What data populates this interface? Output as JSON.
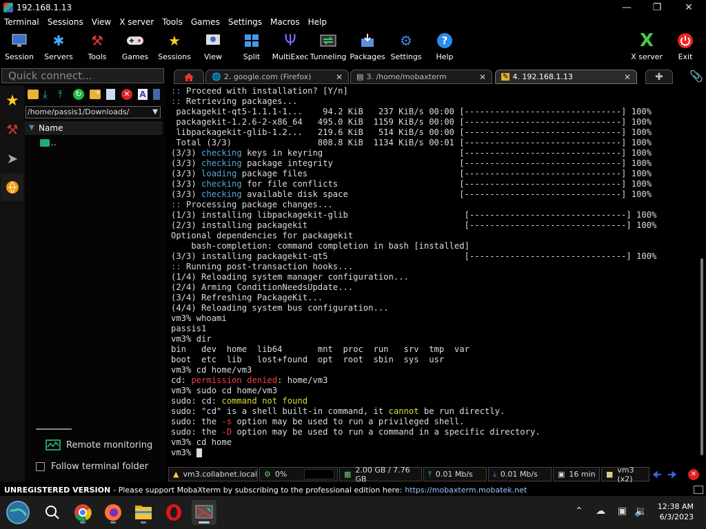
{
  "window": {
    "title": "192.168.1.13"
  },
  "menu": [
    "Terminal",
    "Sessions",
    "View",
    "X server",
    "Tools",
    "Games",
    "Settings",
    "Macros",
    "Help"
  ],
  "toolbar": {
    "items": [
      "Session",
      "Servers",
      "Tools",
      "Games",
      "Sessions",
      "View",
      "Split",
      "MultiExec",
      "Tunneling",
      "Packages",
      "Settings",
      "Help"
    ],
    "xserver": "X server",
    "exit": "Exit"
  },
  "quick_connect": {
    "placeholder": "Quick connect..."
  },
  "tabs": [
    {
      "label": "2. google.com (Firefox)"
    },
    {
      "label": "3. /home/mobaxterm"
    },
    {
      "label": "4. 192.168.1.13"
    }
  ],
  "sftp": {
    "path": "/home/passis1/Downloads/",
    "column": "Name",
    "updir": "..",
    "remote_monitoring": "Remote monitoring",
    "follow_folder": "Follow terminal folder"
  },
  "terminal": {
    "lines": [
      [
        {
          "t": ":: ",
          "c": "cyan"
        },
        {
          "t": "Proceed with installation? [Y/n]"
        }
      ],
      [
        {
          "t": ":: ",
          "c": "cyan"
        },
        {
          "t": "Retrieving packages..."
        }
      ],
      [
        {
          "t": " packagekit-qt5-1.1.1-1...    94.2 KiB   237 KiB/s 00:00 [-------------------------------] 100%"
        }
      ],
      [
        {
          "t": " packagekit-1.2.6-2-x86_64   495.0 KiB  1159 KiB/s 00:00 [-------------------------------] 100%"
        }
      ],
      [
        {
          "t": " libpackagekit-glib-1.2...   219.6 KiB   514 KiB/s 00:00 [-------------------------------] 100%"
        }
      ],
      [
        {
          "t": " Total (3/3)                 808.8 KiB  1134 KiB/s 00:01 [-------------------------------] 100%"
        }
      ],
      [
        {
          "t": "(3/3) "
        },
        {
          "t": "checking",
          "c": "cyan"
        },
        {
          "t": " keys in keyring                           [-------------------------------] 100%"
        }
      ],
      [
        {
          "t": "(3/3) "
        },
        {
          "t": "checking",
          "c": "cyan"
        },
        {
          "t": " package integrity                         [-------------------------------] 100%"
        }
      ],
      [
        {
          "t": "(3/3) "
        },
        {
          "t": "loading",
          "c": "cyan"
        },
        {
          "t": " package files                              [-------------------------------] 100%"
        }
      ],
      [
        {
          "t": "(3/3) "
        },
        {
          "t": "checking",
          "c": "cyan"
        },
        {
          "t": " for file conflicts                        [-------------------------------] 100%"
        }
      ],
      [
        {
          "t": "(3/3) "
        },
        {
          "t": "checking",
          "c": "cyan"
        },
        {
          "t": " available disk space                      [-------------------------------] 100%"
        }
      ],
      [
        {
          "t": ":: ",
          "c": "cyan"
        },
        {
          "t": "Processing package changes..."
        }
      ],
      [
        {
          "t": "(1/3) installing libpackagekit-glib                       [-------------------------------] 100%"
        }
      ],
      [
        {
          "t": "(2/3) installing packagekit                               [-------------------------------] 100%"
        }
      ],
      [
        {
          "t": "Optional dependencies for packagekit"
        }
      ],
      [
        {
          "t": "    bash-completion: command completion in bash [installed]"
        }
      ],
      [
        {
          "t": "(3/3) installing packagekit-qt5                           [-------------------------------] 100%"
        }
      ],
      [
        {
          "t": ":: ",
          "c": "cyan"
        },
        {
          "t": "Running post-transaction hooks..."
        }
      ],
      [
        {
          "t": "(1/4) Reloading system manager configuration..."
        }
      ],
      [
        {
          "t": "(2/4) Arming ConditionNeedsUpdate..."
        }
      ],
      [
        {
          "t": "(3/4) Refreshing PackageKit..."
        }
      ],
      [
        {
          "t": "(4/4) Reloading system bus configuration..."
        }
      ],
      [
        {
          "t": "vm3% whoami"
        }
      ],
      [
        {
          "t": "passis1"
        }
      ],
      [
        {
          "t": "vm3% dir"
        }
      ],
      [
        {
          "t": "bin   dev  home  lib64       mnt  proc  run   srv  tmp  var"
        }
      ],
      [
        {
          "t": "boot  etc  lib   lost+found  opt  root  sbin  sys  usr"
        }
      ],
      [
        {
          "t": "vm3% cd home/vm3"
        }
      ],
      [
        {
          "t": "cd: "
        },
        {
          "t": "permission denied",
          "c": "red"
        },
        {
          "t": ": home/vm3"
        }
      ],
      [
        {
          "t": "vm3% sudo cd home/vm3"
        }
      ],
      [
        {
          "t": "sudo: cd: "
        },
        {
          "t": "command not found",
          "c": "yellow"
        }
      ],
      [
        {
          "t": "sudo: \"cd\" is a shell built-in command, it "
        },
        {
          "t": "cannot",
          "c": "yellow"
        },
        {
          "t": " be run directly."
        }
      ],
      [
        {
          "t": "sudo: the "
        },
        {
          "t": "-s",
          "c": "red"
        },
        {
          "t": " option may be used to run a privileged shell."
        }
      ],
      [
        {
          "t": "sudo: the "
        },
        {
          "t": "-D",
          "c": "red"
        },
        {
          "t": " option may be used to run a command in a specific directory."
        }
      ],
      [
        {
          "t": "vm3% cd home"
        }
      ],
      [
        {
          "t": "vm3% "
        }
      ]
    ]
  },
  "status": {
    "host": "vm3.collabnet.local",
    "cpu": "0%",
    "memory": "2.00 GB / 7.76 GB",
    "upload": "0.01 Mb/s",
    "download": "0.01 Mb/s",
    "uptime": "16 min",
    "users": "vm3 (x2)"
  },
  "unregistered": {
    "label": "UNREGISTERED VERSION",
    "message": " -  Please support MobaXterm by subscribing to the professional edition here:",
    "link": "https://mobaxterm.mobatek.net"
  },
  "clock": {
    "time": "12:38 AM",
    "date": "6/3/2023"
  }
}
